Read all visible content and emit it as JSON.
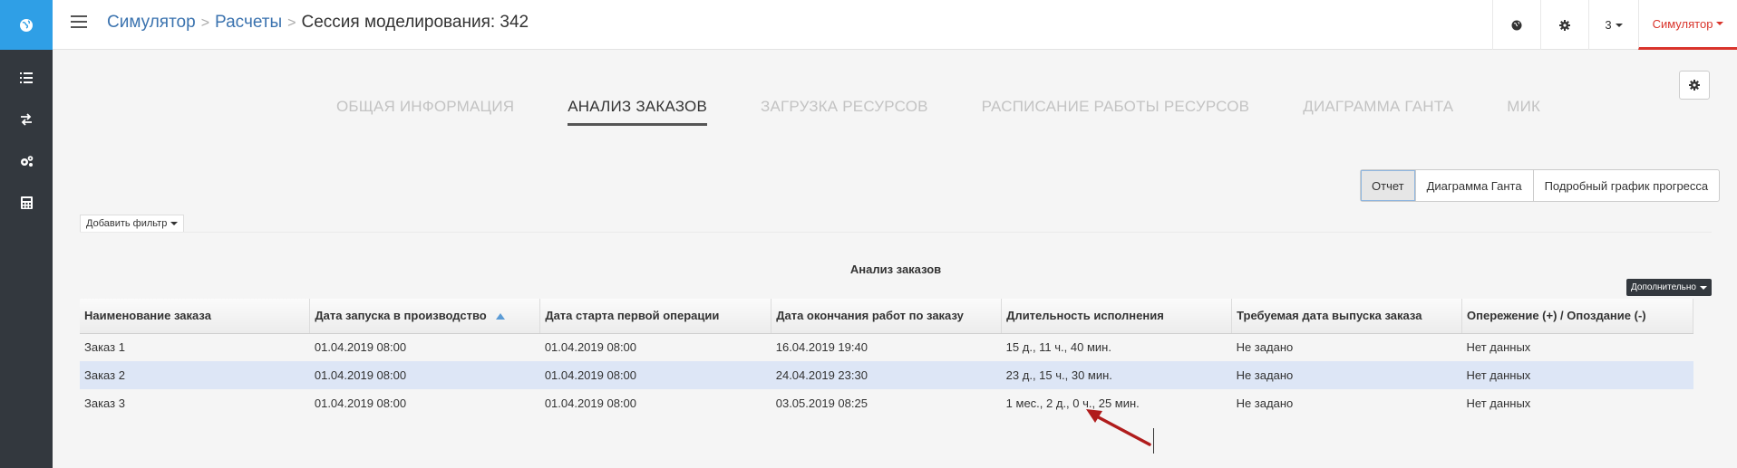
{
  "sidebar": {
    "items": [
      {
        "icon": "globe-icon"
      },
      {
        "icon": "list-icon"
      },
      {
        "icon": "swap-arrows-icon"
      },
      {
        "icon": "gears-icon"
      },
      {
        "icon": "calculator-icon"
      }
    ],
    "logo_color": "#2f9fe6",
    "background": "#33383e"
  },
  "header": {
    "breadcrumb": [
      "Симулятор",
      "Расчеты"
    ],
    "separator": ">",
    "title": "Сессия моделирования: 342",
    "actions": {
      "number": "3",
      "user": "Симулятор"
    },
    "accent_color": "#d9342b"
  },
  "tabs": [
    {
      "label": "ОБЩАЯ ИНФОРМАЦИЯ",
      "active": false
    },
    {
      "label": "АНАЛИЗ ЗАКАЗОВ",
      "active": true
    },
    {
      "label": "ЗАГРУЗКА РЕСУРСОВ",
      "active": false
    },
    {
      "label": "РАСПИСАНИЕ РАБОТЫ РЕСУРСОВ",
      "active": false
    },
    {
      "label": "ДИАГРАММА ГАНТА",
      "active": false
    },
    {
      "label": "МИК",
      "active": false
    }
  ],
  "view_switch": [
    {
      "label": "Отчет",
      "active": true
    },
    {
      "label": "Диаграмма Ганта",
      "active": false
    },
    {
      "label": "Подробный график прогресса",
      "active": false
    }
  ],
  "filter": {
    "label": "Добавить фильтр"
  },
  "report": {
    "title": "Анализ заказов",
    "more_label": "Дополнительно",
    "columns": [
      "Наименование заказа",
      "Дата запуска в производство",
      "Дата старта первой операции",
      "Дата окончания работ по заказу",
      "Длительность исполнения",
      "Требуемая дата выпуска заказа",
      "Опережение (+) / Опоздание (-)"
    ],
    "sorted_column": 1,
    "rows": [
      [
        "Заказ 1",
        "01.04.2019 08:00",
        "01.04.2019 08:00",
        "16.04.2019 19:40",
        "15 д., 11 ч., 40 мин.",
        "Не задано",
        "Нет данных"
      ],
      [
        "Заказ 2",
        "01.04.2019 08:00",
        "01.04.2019 08:00",
        "24.04.2019 23:30",
        "23 д., 15 ч., 30 мин.",
        "Не задано",
        "Нет данных"
      ],
      [
        "Заказ 3",
        "01.04.2019 08:00",
        "01.04.2019 08:00",
        "03.05.2019 08:25",
        "1 мес., 2 д., 0 ч., 25 мин.",
        "Не задано",
        "Нет данных"
      ]
    ],
    "selected_row": 1,
    "selection_color": "#dde6f6"
  },
  "annotation": {
    "color": "#b01c1c",
    "icon": "red-arrow-icon"
  }
}
